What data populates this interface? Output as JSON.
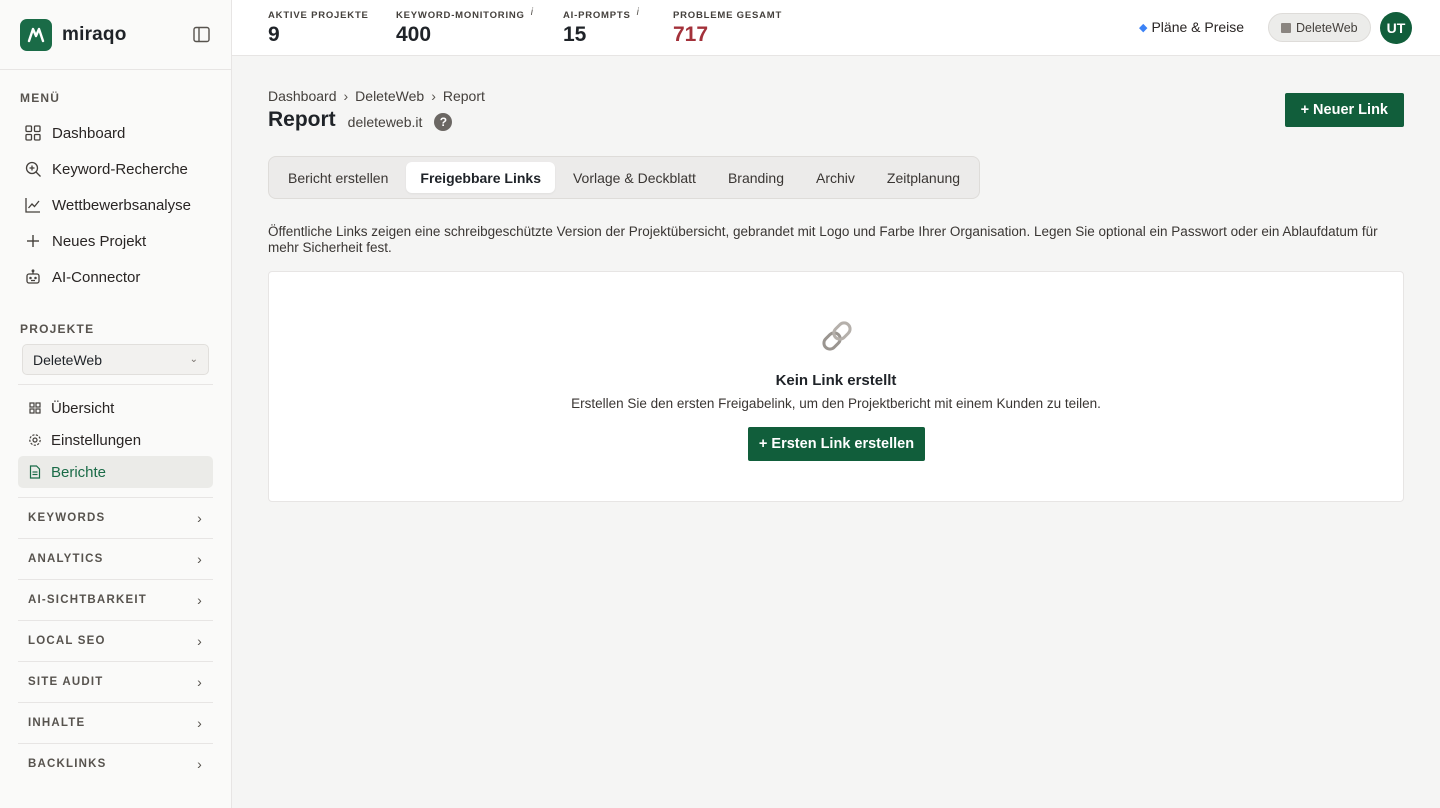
{
  "brand": {
    "name": "miraqo"
  },
  "sidebar": {
    "menu_label": "MENÜ",
    "menu": [
      {
        "label": "Dashboard",
        "icon": "grid-icon"
      },
      {
        "label": "Keyword-Recherche",
        "icon": "search-plus-icon"
      },
      {
        "label": "Wettbewerbsanalyse",
        "icon": "chart-line-icon"
      },
      {
        "label": "Neues Projekt",
        "icon": "plus-icon"
      },
      {
        "label": "AI-Connector",
        "icon": "robot-icon"
      }
    ],
    "projects_label": "PROJEKTE",
    "project_select": {
      "value": "DeleteWeb"
    },
    "project_nav": [
      {
        "label": "Übersicht",
        "icon": "grid-small-icon"
      },
      {
        "label": "Einstellungen",
        "icon": "gear-icon"
      },
      {
        "label": "Berichte",
        "icon": "document-icon",
        "active": true
      }
    ],
    "groups": [
      {
        "label": "KEYWORDS"
      },
      {
        "label": "ANALYTICS"
      },
      {
        "label": "AI-SICHTBARKEIT"
      },
      {
        "label": "LOCAL SEO"
      },
      {
        "label": "SITE AUDIT"
      },
      {
        "label": "INHALTE"
      },
      {
        "label": "BACKLINKS"
      }
    ]
  },
  "topbar": {
    "stats": [
      {
        "label": "AKTIVE PROJEKTE",
        "value": "9",
        "info": ""
      },
      {
        "label": "KEYWORD-MONITORING",
        "value": "400",
        "info": "i"
      },
      {
        "label": "AI-PROMPTS",
        "value": "15",
        "info": "i"
      },
      {
        "label": "PROBLEME GESAMT",
        "value": "717",
        "info": ""
      }
    ],
    "plans_label": "Pläne & Preise",
    "project_pill": "DeleteWeb",
    "avatar_initials": "UT",
    "colors": {
      "accent": "#115e3b",
      "problems": "#a3313a"
    }
  },
  "page": {
    "breadcrumb": [
      "Dashboard",
      "DeleteWeb",
      "Report"
    ],
    "breadcrumb_sep": "›",
    "title": "Report",
    "domain": "deleteweb.it",
    "help": "?",
    "new_link_button": "+ Neuer Link",
    "tabs": [
      {
        "label": "Bericht erstellen"
      },
      {
        "label": "Freigebbare Links",
        "active": true
      },
      {
        "label": "Vorlage & Deckblatt"
      },
      {
        "label": "Branding"
      },
      {
        "label": "Archiv"
      },
      {
        "label": "Zeitplanung"
      }
    ],
    "description": "Öffentliche Links zeigen eine schreibgeschützte Version der Projektübersicht, gebrandet mit Logo und Farbe Ihrer Organisation. Legen Sie optional ein Passwort oder ein Ablaufdatum für mehr Sicherheit fest.",
    "empty": {
      "icon": "link-icon",
      "title": "Kein Link erstellt",
      "text": "Erstellen Sie den ersten Freigabelink, um den Projektbericht mit einem Kunden zu teilen.",
      "button": "+ Ersten Link erstellen"
    }
  }
}
